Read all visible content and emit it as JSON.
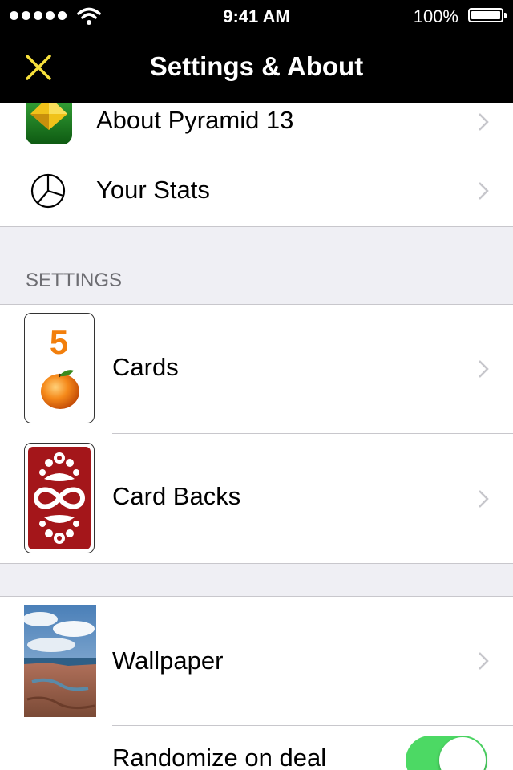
{
  "status_bar": {
    "time": "9:41 AM",
    "battery_percent": "100%",
    "signal_bars": 5,
    "battery_level": 1.0
  },
  "nav": {
    "title": "Settings & About",
    "close_icon": "close-x-icon",
    "accent_color": "#f7e03c"
  },
  "about_group": {
    "items": [
      {
        "label": "About Pyramid 13",
        "icon": "pyramid-app-icon"
      },
      {
        "label": "Your Stats",
        "icon": "pie-chart-icon"
      }
    ]
  },
  "settings_section": {
    "header": "SETTINGS",
    "items": [
      {
        "label": "Cards",
        "icon": "card-face-icon",
        "card_value": "5",
        "card_value_color": "#f27f0c"
      },
      {
        "label": "Card Backs",
        "icon": "card-back-icon",
        "card_back_color": "#a4161a"
      }
    ]
  },
  "appearance_group": {
    "items": [
      {
        "label": "Wallpaper",
        "icon": "wallpaper-thumbnail"
      },
      {
        "label": "Randomize on deal",
        "control": "toggle",
        "on": true
      }
    ]
  },
  "colors": {
    "toggle_on": "#4cd964",
    "chevron": "#c7c7cc",
    "separator": "#c8c7cc",
    "group_background": "#efeff4"
  }
}
